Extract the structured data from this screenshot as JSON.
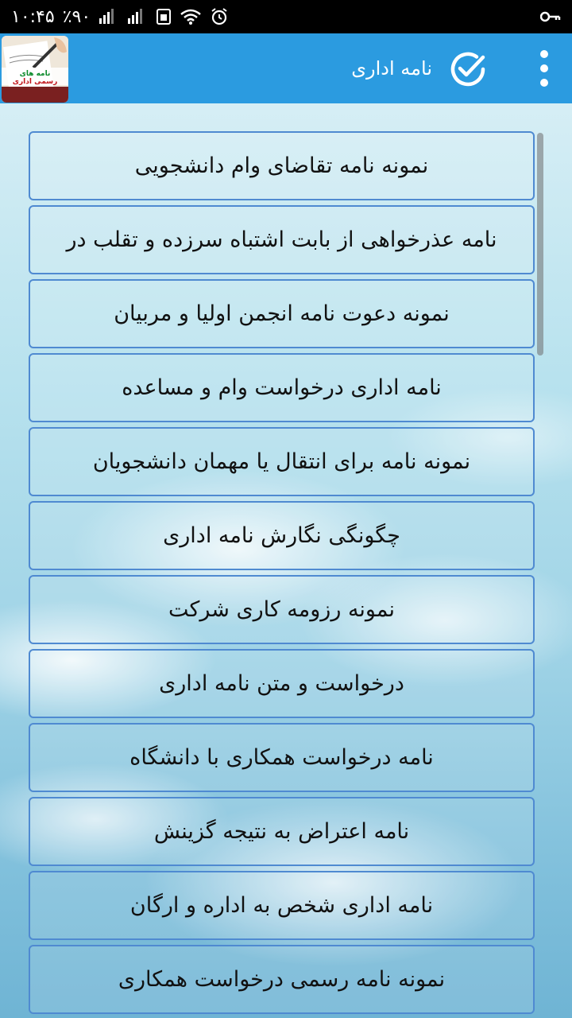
{
  "status_bar": {
    "time": "۱۰:۴۵",
    "battery": "٪۹۰"
  },
  "app_bar": {
    "title": "نامه اداری",
    "logo_text_line1": "نامه های",
    "logo_text_line2": "رسمی اداری"
  },
  "icons": {
    "check": "check-circle-icon",
    "menu": "more-vert-icon"
  },
  "colors": {
    "app_bar": "#2b9be0",
    "item_border": "#4f8ad1"
  },
  "items": [
    {
      "label": "نمونه نامه تقاضای وام دانشجویی"
    },
    {
      "label": "نامه عذرخواهی از بابت اشتباه سرزده و تقلب در"
    },
    {
      "label": "نمونه دعوت نامه انجمن اولیا و مربیان"
    },
    {
      "label": "نامه اداری درخواست وام و مساعده"
    },
    {
      "label": "نمونه نامه برای انتقال یا مهمان دانشجویان"
    },
    {
      "label": "چگونگی نگارش نامه اداری"
    },
    {
      "label": "نمونه رزومه کاری شرکت"
    },
    {
      "label": "درخواست و متن نامه اداری"
    },
    {
      "label": "نامه درخواست همکاری با دانشگاه"
    },
    {
      "label": "نامه اعتراض به نتیجه گزینش"
    },
    {
      "label": "نامه اداری شخص به اداره و ارگان"
    },
    {
      "label": "نمونه نامه رسمی درخواست همکاری"
    }
  ]
}
